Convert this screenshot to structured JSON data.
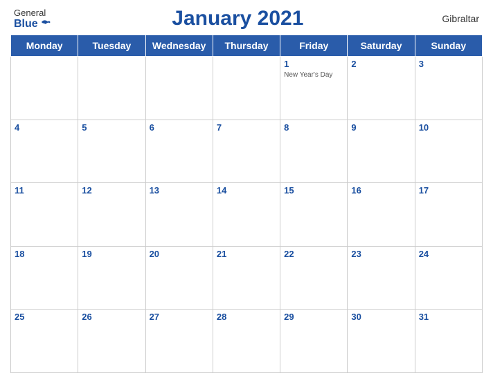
{
  "header": {
    "logo_general": "General",
    "logo_blue": "Blue",
    "title": "January 2021",
    "country": "Gibraltar"
  },
  "weekdays": [
    "Monday",
    "Tuesday",
    "Wednesday",
    "Thursday",
    "Friday",
    "Saturday",
    "Sunday"
  ],
  "weeks": [
    [
      {
        "day": "",
        "holiday": ""
      },
      {
        "day": "",
        "holiday": ""
      },
      {
        "day": "",
        "holiday": ""
      },
      {
        "day": "",
        "holiday": ""
      },
      {
        "day": "1",
        "holiday": "New Year's Day"
      },
      {
        "day": "2",
        "holiday": ""
      },
      {
        "day": "3",
        "holiday": ""
      }
    ],
    [
      {
        "day": "4",
        "holiday": ""
      },
      {
        "day": "5",
        "holiday": ""
      },
      {
        "day": "6",
        "holiday": ""
      },
      {
        "day": "7",
        "holiday": ""
      },
      {
        "day": "8",
        "holiday": ""
      },
      {
        "day": "9",
        "holiday": ""
      },
      {
        "day": "10",
        "holiday": ""
      }
    ],
    [
      {
        "day": "11",
        "holiday": ""
      },
      {
        "day": "12",
        "holiday": ""
      },
      {
        "day": "13",
        "holiday": ""
      },
      {
        "day": "14",
        "holiday": ""
      },
      {
        "day": "15",
        "holiday": ""
      },
      {
        "day": "16",
        "holiday": ""
      },
      {
        "day": "17",
        "holiday": ""
      }
    ],
    [
      {
        "day": "18",
        "holiday": ""
      },
      {
        "day": "19",
        "holiday": ""
      },
      {
        "day": "20",
        "holiday": ""
      },
      {
        "day": "21",
        "holiday": ""
      },
      {
        "day": "22",
        "holiday": ""
      },
      {
        "day": "23",
        "holiday": ""
      },
      {
        "day": "24",
        "holiday": ""
      }
    ],
    [
      {
        "day": "25",
        "holiday": ""
      },
      {
        "day": "26",
        "holiday": ""
      },
      {
        "day": "27",
        "holiday": ""
      },
      {
        "day": "28",
        "holiday": ""
      },
      {
        "day": "29",
        "holiday": ""
      },
      {
        "day": "30",
        "holiday": ""
      },
      {
        "day": "31",
        "holiday": ""
      }
    ]
  ]
}
